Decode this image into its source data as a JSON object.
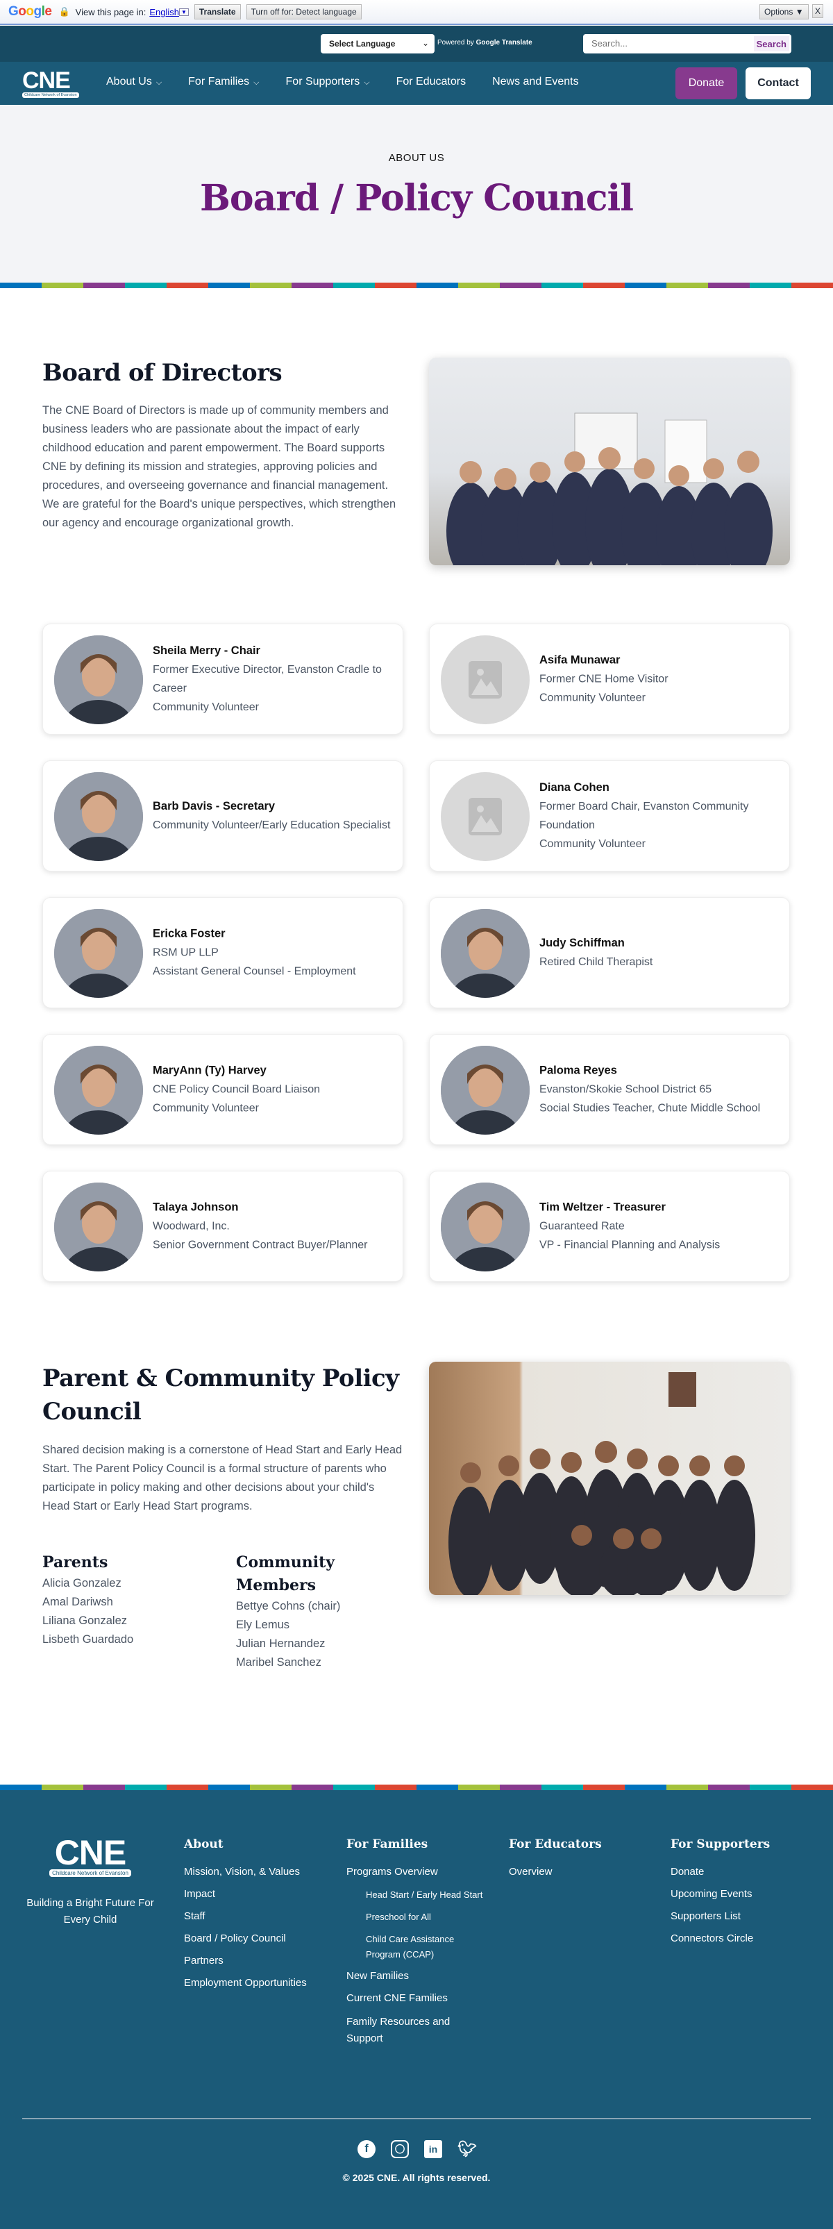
{
  "google_bar": {
    "logo": "Google",
    "view_label": "View this page in:",
    "language": "English",
    "translate": "Translate",
    "turn_off": "Turn off for: Detect language",
    "options": "Options ▼",
    "close": "X"
  },
  "topbar": {
    "select_language": "Select Language",
    "powered_by": "Powered by",
    "translate_brand": "Google Translate",
    "search_placeholder": "Search...",
    "search_button": "Search"
  },
  "nav": {
    "logo": "CNE",
    "logo_sub": "Childcare Network of Evanston",
    "items": [
      {
        "label": "About Us",
        "dropdown": true
      },
      {
        "label": "For Families",
        "dropdown": true
      },
      {
        "label": "For Supporters",
        "dropdown": true
      },
      {
        "label": "For Educators"
      },
      {
        "label": "News and Events"
      }
    ],
    "donate": "Donate",
    "contact": "Contact"
  },
  "hero": {
    "eyebrow": "ABOUT US",
    "title": "Board / Policy Council"
  },
  "stripe_colors": [
    "#0072bc",
    "#a3c13c",
    "#873a8e",
    "#00aaad",
    "#dc4632"
  ],
  "board": {
    "title": "Board of Directors",
    "description": "The CNE Board of Directors is made up of community members and business leaders who are passionate about the impact of early childhood education and parent empowerment. The Board supports CNE by defining its mission and strategies, approving policies and procedures, and overseeing governance and financial management. We are grateful for the Board's unique perspectives, which strengthen our agency and encourage organizational growth.",
    "members": [
      {
        "name": "Sheila Merry - Chair",
        "lines": [
          "Former Executive Director, Evanston Cradle to Career",
          "Community Volunteer"
        ],
        "photo": true
      },
      {
        "name": "Asifa Munawar",
        "lines": [
          "Former CNE Home Visitor",
          "Community Volunteer"
        ],
        "photo": false
      },
      {
        "name": "Barb Davis - Secretary",
        "lines": [
          "Community Volunteer/Early Education Specialist"
        ],
        "photo": true
      },
      {
        "name": "Diana Cohen",
        "lines": [
          "Former Board Chair, Evanston Community Foundation",
          "Community Volunteer"
        ],
        "photo": false
      },
      {
        "name": "Ericka Foster",
        "lines": [
          "RSM UP LLP",
          "Assistant General Counsel - Employment"
        ],
        "photo": true
      },
      {
        "name": "Judy Schiffman",
        "lines": [
          "Retired Child Therapist"
        ],
        "photo": true
      },
      {
        "name": "MaryAnn (Ty) Harvey",
        "lines": [
          "CNE Policy Council Board Liaison",
          "Community Volunteer"
        ],
        "photo": true
      },
      {
        "name": "Paloma Reyes",
        "lines": [
          "Evanston/Skokie School District 65",
          "Social Studies Teacher, Chute Middle School"
        ],
        "photo": true
      },
      {
        "name": "Talaya Johnson",
        "lines": [
          "Woodward, Inc.",
          "Senior Government Contract Buyer/Planner"
        ],
        "photo": true
      },
      {
        "name": "Tim Weltzer - Treasurer",
        "lines": [
          "Guaranteed Rate",
          "VP - Financial Planning and Analysis"
        ],
        "photo": true
      }
    ]
  },
  "council": {
    "title": "Parent & Community Policy Council",
    "description": "Shared decision making is a cornerstone of Head Start and Early Head Start. The Parent Policy Council is a formal structure of parents who participate in policy making and other decisions about your child's Head Start or Early Head Start programs.",
    "parents_title": "Parents",
    "parents": [
      "Alicia Gonzalez",
      "Amal Dariwsh",
      "Liliana Gonzalez",
      "Lisbeth Guardado"
    ],
    "community_title": "Community Members",
    "community": [
      "Bettye Cohns (chair)",
      "Ely Lemus",
      "Julian Hernandez",
      "Maribel Sanchez"
    ]
  },
  "footer": {
    "logo": "CNE",
    "logo_sub": "Childcare Network of Evanston",
    "tagline": "Building a Bright Future For Every Child",
    "about": {
      "title": "About",
      "items": [
        "Mission, Vision, & Values",
        "Impact",
        "Staff",
        "Board / Policy Council",
        "Partners",
        "Employment Opportunities"
      ]
    },
    "families": {
      "title": "For Families",
      "items": [
        "Programs Overview",
        "New Families",
        "Current CNE Families",
        "Family Resources and Support"
      ],
      "sub_items": [
        "Head Start / Early Head Start",
        "Preschool for All",
        "Child Care Assistance Program (CCAP)"
      ]
    },
    "educators": {
      "title": "For Educators",
      "items": [
        "Overview"
      ]
    },
    "supporters": {
      "title": "For Supporters",
      "items": [
        "Donate",
        "Upcoming Events",
        "Supporters List",
        "Connectors Circle"
      ]
    },
    "social": [
      "facebook-icon",
      "instagram-icon",
      "linkedin-icon",
      "twitter-icon"
    ],
    "copyright": "© 2025 CNE. All rights reserved."
  }
}
